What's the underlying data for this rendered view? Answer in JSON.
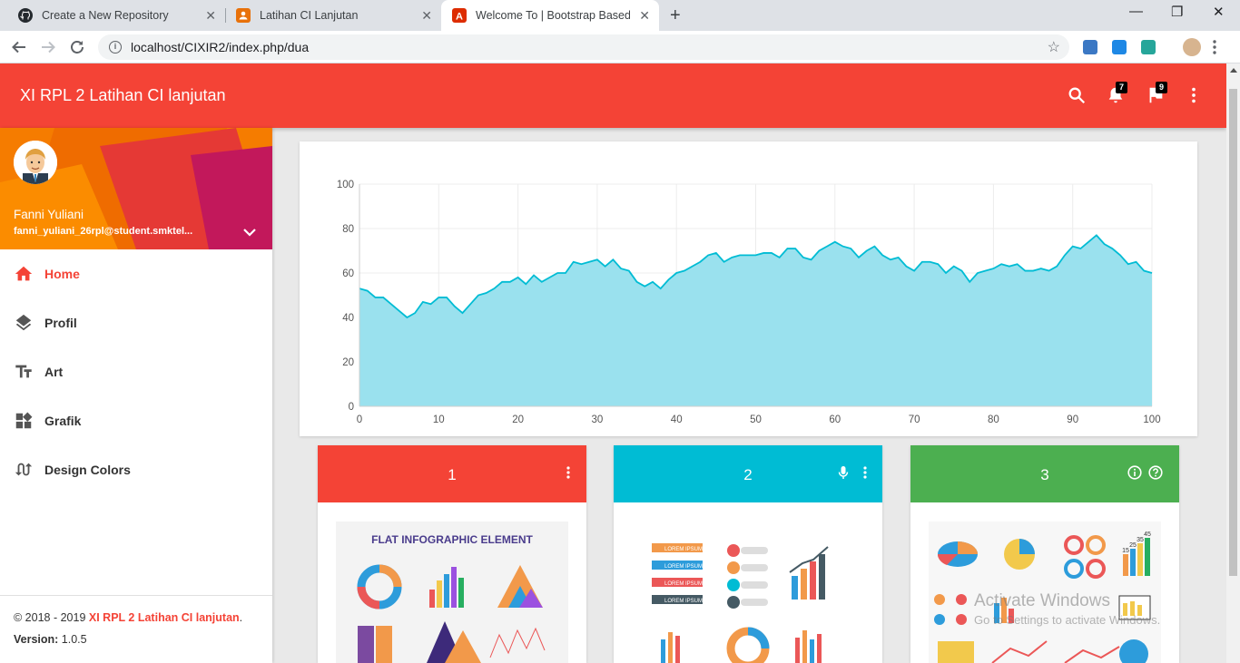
{
  "browser": {
    "tabs": [
      {
        "title": "Create a New Repository",
        "favicon": "github-icon"
      },
      {
        "title": "Latihan CI Lanjutan",
        "favicon": "user-folder-icon"
      },
      {
        "title": "Welcome To | Bootstrap Based A",
        "favicon": "angular-icon"
      }
    ],
    "url": "localhost/CIXIR2/index.php/dua"
  },
  "app": {
    "title": "XI RPL 2 Latihan CI lanjutan",
    "accent": "#f44336",
    "notifications_count": "7",
    "flags_count": "9"
  },
  "user": {
    "name": "Fanni Yuliani",
    "email": "fanni_yuliani_26rpl@student.smktel..."
  },
  "menu": [
    {
      "label": "Home",
      "icon": "home-icon"
    },
    {
      "label": "Profil",
      "icon": "layers-icon"
    },
    {
      "label": "Art",
      "icon": "text-fields-icon"
    },
    {
      "label": "Grafik",
      "icon": "widgets-icon"
    },
    {
      "label": "Design Colors",
      "icon": "swap-calls-icon"
    }
  ],
  "footer": {
    "copyright_prefix": "© 2018 - 2019 ",
    "copyright_name": "XI RPL 2 Latihan CI lanjutan",
    "copyright_suffix": ".",
    "version_label": "Version:",
    "version_value": " 1.0.5"
  },
  "chart_data": {
    "type": "area",
    "xlim": [
      0,
      100
    ],
    "ylim": [
      0,
      100
    ],
    "xticks": [
      0,
      10,
      20,
      30,
      40,
      50,
      60,
      70,
      80,
      90,
      100
    ],
    "yticks": [
      0,
      20,
      40,
      60,
      80,
      100
    ],
    "grid": true,
    "fill_color": "#9ae1ee",
    "line_color": "#00bcd4",
    "x": [
      0,
      1,
      2,
      3,
      4,
      5,
      6,
      7,
      8,
      9,
      10,
      11,
      12,
      13,
      14,
      15,
      16,
      17,
      18,
      19,
      20,
      21,
      22,
      23,
      24,
      25,
      26,
      27,
      28,
      29,
      30,
      31,
      32,
      33,
      34,
      35,
      36,
      37,
      38,
      39,
      40,
      41,
      42,
      43,
      44,
      45,
      46,
      47,
      48,
      49,
      50,
      51,
      52,
      53,
      54,
      55,
      56,
      57,
      58,
      59,
      60,
      61,
      62,
      63,
      64,
      65,
      66,
      67,
      68,
      69,
      70,
      71,
      72,
      73,
      74,
      75,
      76,
      77,
      78,
      79,
      80,
      81,
      82,
      83,
      84,
      85,
      86,
      87,
      88,
      89,
      90,
      91,
      92,
      93,
      94,
      95,
      96,
      97,
      98,
      99,
      100
    ],
    "y": [
      53,
      52,
      49,
      49,
      46,
      43,
      40,
      42,
      47,
      46,
      49,
      49,
      45,
      42,
      46,
      50,
      51,
      53,
      56,
      56,
      58,
      55,
      59,
      56,
      58,
      60,
      60,
      65,
      64,
      65,
      66,
      63,
      66,
      62,
      61,
      56,
      54,
      56,
      53,
      57,
      60,
      61,
      63,
      65,
      68,
      69,
      65,
      67,
      68,
      68,
      68,
      69,
      69,
      67,
      71,
      71,
      67,
      66,
      70,
      72,
      74,
      72,
      71,
      67,
      70,
      72,
      68,
      66,
      67,
      63,
      61,
      65,
      65,
      64,
      60,
      63,
      61,
      56,
      60,
      61,
      62,
      64,
      63,
      64,
      61,
      61,
      62,
      61,
      63,
      68,
      72,
      71,
      74,
      77,
      73,
      71,
      68,
      64,
      65,
      61,
      60,
      59
    ]
  },
  "cards": [
    {
      "title": "1",
      "color": "#f44336",
      "icons": [
        "more-vert-icon"
      ],
      "image_title": "FLAT INFOGRAPHIC ELEMENT"
    },
    {
      "title": "2",
      "color": "#00bcd4",
      "icons": [
        "mic-icon",
        "more-vert-icon"
      ],
      "image_labels": [
        "LOREM IPSUM",
        "LOREM IPSUM",
        "LOREM IPSUM",
        "LOREM IPSUM"
      ]
    },
    {
      "title": "3",
      "color": "#4caf50",
      "icons": [
        "info-icon",
        "help-icon"
      ],
      "image_labels": [
        "15",
        "25",
        "35",
        "45"
      ]
    }
  ],
  "watermark": {
    "line1": "Activate Windows",
    "line2": "Go to Settings to activate Windows."
  }
}
